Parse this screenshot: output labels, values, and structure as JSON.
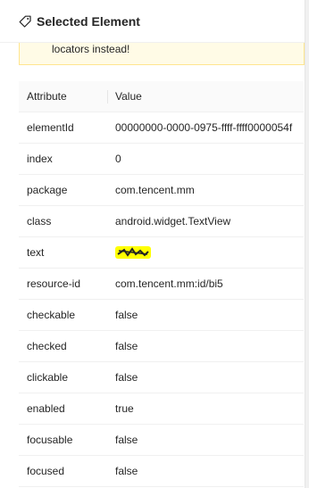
{
  "panel": {
    "title": "Selected Element",
    "icon": "tag-icon",
    "warning_text": "locators instead!"
  },
  "table": {
    "headers": {
      "attribute": "Attribute",
      "value": "Value"
    },
    "rows": [
      {
        "attr": "elementId",
        "value": "00000000-0000-0975-ffff-ffff0000054f"
      },
      {
        "attr": "index",
        "value": "0"
      },
      {
        "attr": "package",
        "value": "com.tencent.mm"
      },
      {
        "attr": "class",
        "value": "android.widget.TextView"
      },
      {
        "attr": "text",
        "value": ""
      },
      {
        "attr": "resource-id",
        "value": "com.tencent.mm:id/bi5"
      },
      {
        "attr": "checkable",
        "value": "false"
      },
      {
        "attr": "checked",
        "value": "false"
      },
      {
        "attr": "clickable",
        "value": "false"
      },
      {
        "attr": "enabled",
        "value": "true"
      },
      {
        "attr": "focusable",
        "value": "false"
      },
      {
        "attr": "focused",
        "value": "false"
      }
    ]
  },
  "colors": {
    "warning_bg": "#fffbe6",
    "warning_border": "#ffe58f",
    "redaction": "#ffff00"
  }
}
